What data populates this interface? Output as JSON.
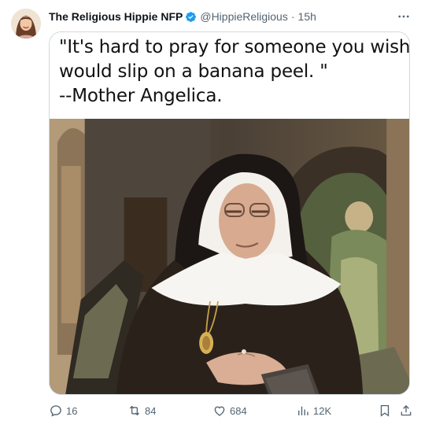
{
  "tweet": {
    "author": {
      "display_name": "The Religious Hippie NFP",
      "handle": "@HippieReligious",
      "verified": true,
      "avatar": "avatar-photo"
    },
    "separator": "·",
    "time": "15h",
    "more_icon": "ellipsis-icon"
  },
  "media": {
    "quote_lines": [
      "\"It's hard to pray for someone you wish",
      "would slip on a banana peel. \"",
      "--Mother Angelica."
    ],
    "photo": "photo of an elderly nun in a black-and-white habit seated in a chapel"
  },
  "actions": {
    "reply": {
      "icon": "reply-icon",
      "count": "16"
    },
    "retweet": {
      "icon": "retweet-icon",
      "count": "84"
    },
    "like": {
      "icon": "heart-icon",
      "count": "684"
    },
    "views": {
      "icon": "views-icon",
      "count": "12K"
    },
    "bookmark": {
      "icon": "bookmark-icon"
    },
    "share": {
      "icon": "share-icon"
    }
  },
  "colors": {
    "text": "#0f1419",
    "muted": "#536471",
    "verified": "#1d9bf0",
    "border": "#cfd9de"
  }
}
